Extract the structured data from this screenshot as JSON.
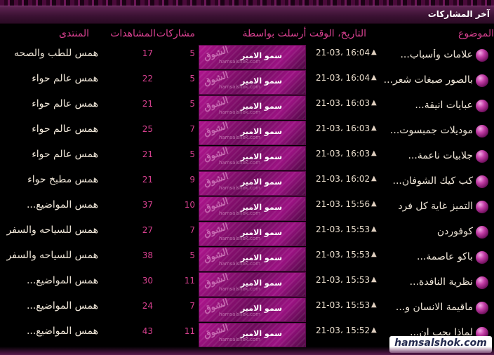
{
  "title": "آخر المشاركات",
  "headers": {
    "topic": "الموضوع",
    "date": "التاريخ، الوقت أرسلت بواسطة",
    "posts": "مشاركات",
    "views": "المشاهدات",
    "forum": "المنتدى"
  },
  "icons": {
    "topic": "pink-orb-icon",
    "newest": "triangle-up-icon"
  },
  "poster_card": {
    "logo_text": "الشوق",
    "site_text": "hamsalshok.com"
  },
  "rows": [
    {
      "topic": "علامات وأسباب...",
      "date": "21-03، 16:04",
      "poster": "سمو الامير",
      "posts": "5",
      "views": "17",
      "forum": "همس للطب والصحه"
    },
    {
      "topic": "بالصور صبغات شعر...",
      "date": "21-03، 16:04",
      "poster": "سمو الامير",
      "posts": "5",
      "views": "22",
      "forum": "همس عالم حواء"
    },
    {
      "topic": "عبايات انيقة...",
      "date": "21-03، 16:03",
      "poster": "سمو الامير",
      "posts": "5",
      "views": "21",
      "forum": "همس عالم حواء"
    },
    {
      "topic": "موديلات جمبسوت...",
      "date": "21-03، 16:03",
      "poster": "سمو الامير",
      "posts": "7",
      "views": "25",
      "forum": "همس عالم حواء"
    },
    {
      "topic": "جلابيات ناعمة...",
      "date": "21-03، 16:03",
      "poster": "سمو الامير",
      "posts": "5",
      "views": "21",
      "forum": "همس عالم حواء"
    },
    {
      "topic": "كب كيك الشوفان...",
      "date": "21-03، 16:02",
      "poster": "سمو الامير",
      "posts": "9",
      "views": "21",
      "forum": "همس مطبخ حواء"
    },
    {
      "topic": "التميز غاية كل فرد",
      "date": "21-03، 15:56",
      "poster": "سمو الامير",
      "posts": "10",
      "views": "37",
      "forum": "همس المواضيع..."
    },
    {
      "topic": "كوفوردن",
      "date": "21-03، 15:53",
      "poster": "سمو الامير",
      "posts": "7",
      "views": "27",
      "forum": "همس للسياحه والسفر"
    },
    {
      "topic": "باكو عاصمة...",
      "date": "21-03، 15:53",
      "poster": "سمو الامير",
      "posts": "5",
      "views": "38",
      "forum": "همس للسياحه والسفر"
    },
    {
      "topic": "نظرية النافدة...",
      "date": "21-03، 15:53",
      "poster": "سمو الامير",
      "posts": "11",
      "views": "30",
      "forum": "همس المواضيع..."
    },
    {
      "topic": "ماقيمة الانسان و...",
      "date": "21-03، 15:53",
      "poster": "سمو الامير",
      "posts": "7",
      "views": "24",
      "forum": "همس المواضيع..."
    },
    {
      "topic": "لماذا يجب ان...",
      "date": "21-03، 15:52",
      "poster": "سمو الامير",
      "posts": "11",
      "views": "43",
      "forum": "همس المواضيع..."
    }
  ],
  "watermark": "hamsalshok.com"
}
